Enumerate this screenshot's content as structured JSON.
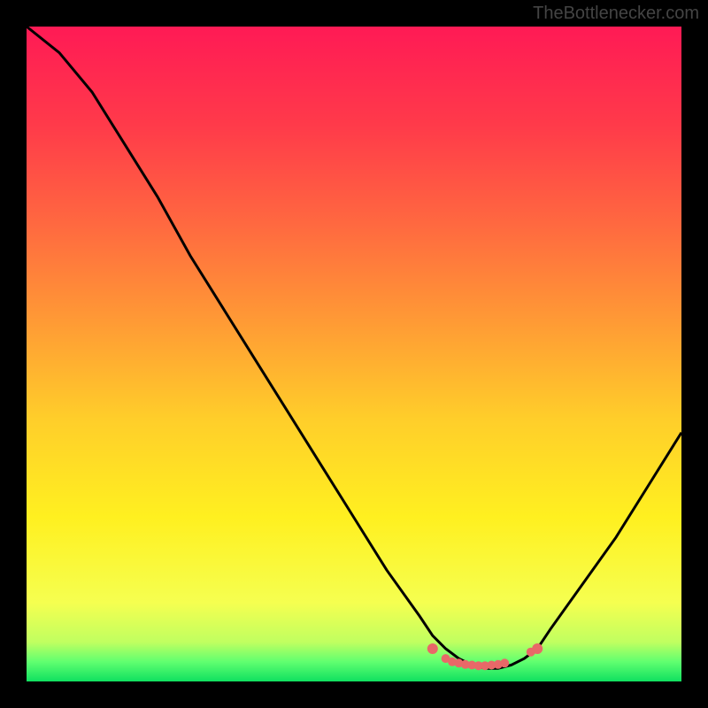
{
  "watermark": "TheBottlenecker.com",
  "chart_data": {
    "type": "line",
    "title": "",
    "xlabel": "",
    "ylabel": "",
    "xlim": [
      0,
      100
    ],
    "ylim": [
      0,
      100
    ],
    "x": [
      0,
      5,
      10,
      15,
      20,
      25,
      30,
      35,
      40,
      45,
      50,
      55,
      60,
      62,
      64,
      66,
      68,
      70,
      72,
      74,
      76,
      78,
      80,
      85,
      90,
      95,
      100
    ],
    "y": [
      100,
      96,
      90,
      82,
      74,
      65,
      57,
      49,
      41,
      33,
      25,
      17,
      10,
      7,
      5,
      3.5,
      2.5,
      2,
      2,
      2.5,
      3.5,
      5,
      8,
      15,
      22,
      30,
      38
    ],
    "markers": {
      "x": [
        62,
        64,
        65,
        66,
        67,
        68,
        69,
        70,
        71,
        72,
        73,
        77,
        78
      ],
      "y": [
        5,
        3.5,
        3,
        2.8,
        2.6,
        2.5,
        2.4,
        2.4,
        2.5,
        2.6,
        2.8,
        4.5,
        5
      ],
      "color": "#e86868"
    },
    "gradient_stops": [
      {
        "offset": 0,
        "color": "#ff1a55"
      },
      {
        "offset": 15,
        "color": "#ff3a4a"
      },
      {
        "offset": 30,
        "color": "#ff6840"
      },
      {
        "offset": 45,
        "color": "#ff9a35"
      },
      {
        "offset": 60,
        "color": "#ffce2a"
      },
      {
        "offset": 75,
        "color": "#fff020"
      },
      {
        "offset": 88,
        "color": "#f5ff50"
      },
      {
        "offset": 94,
        "color": "#c0ff60"
      },
      {
        "offset": 97,
        "color": "#60ff70"
      },
      {
        "offset": 100,
        "color": "#10e060"
      }
    ]
  }
}
